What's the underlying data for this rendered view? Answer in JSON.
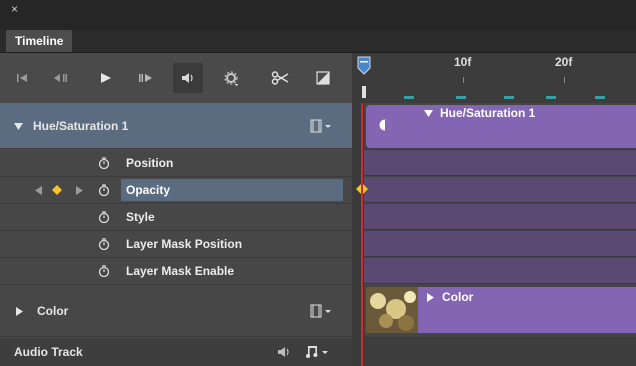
{
  "window": {
    "close_glyph": "×"
  },
  "panel": {
    "tab_label": "Timeline"
  },
  "toolbar": {
    "buttons": [
      {
        "name": "go-to-first-frame",
        "icon": "first-frame-icon"
      },
      {
        "name": "go-to-previous-frame",
        "icon": "previous-frame-icon"
      },
      {
        "name": "play",
        "icon": "play-icon"
      },
      {
        "name": "go-to-next-frame",
        "icon": "next-frame-icon"
      },
      {
        "name": "mute-audio",
        "icon": "speaker-icon"
      },
      {
        "name": "playback-settings",
        "icon": "gear-icon"
      },
      {
        "name": "split-at-playhead",
        "icon": "scissors-icon"
      },
      {
        "name": "transition",
        "icon": "transition-icon"
      }
    ]
  },
  "ruler": {
    "labels": [
      "10f",
      "20f"
    ]
  },
  "tracks": {
    "group1": {
      "label": "Hue/Saturation 1",
      "clip_label": "Hue/Saturation 1"
    },
    "properties": [
      {
        "label": "Position"
      },
      {
        "label": "Opacity",
        "selected": true,
        "has_keyframe": true
      },
      {
        "label": "Style"
      },
      {
        "label": "Layer Mask Position"
      },
      {
        "label": "Layer Mask Enable"
      }
    ],
    "group2": {
      "label": "Color",
      "clip_label": "Color"
    },
    "audio": {
      "label": "Audio Track"
    }
  },
  "colors": {
    "selected_row": "#5c6c80",
    "clip": "#8465b3",
    "playhead": "#d52a2a",
    "keyframe": "#f3c52b"
  }
}
